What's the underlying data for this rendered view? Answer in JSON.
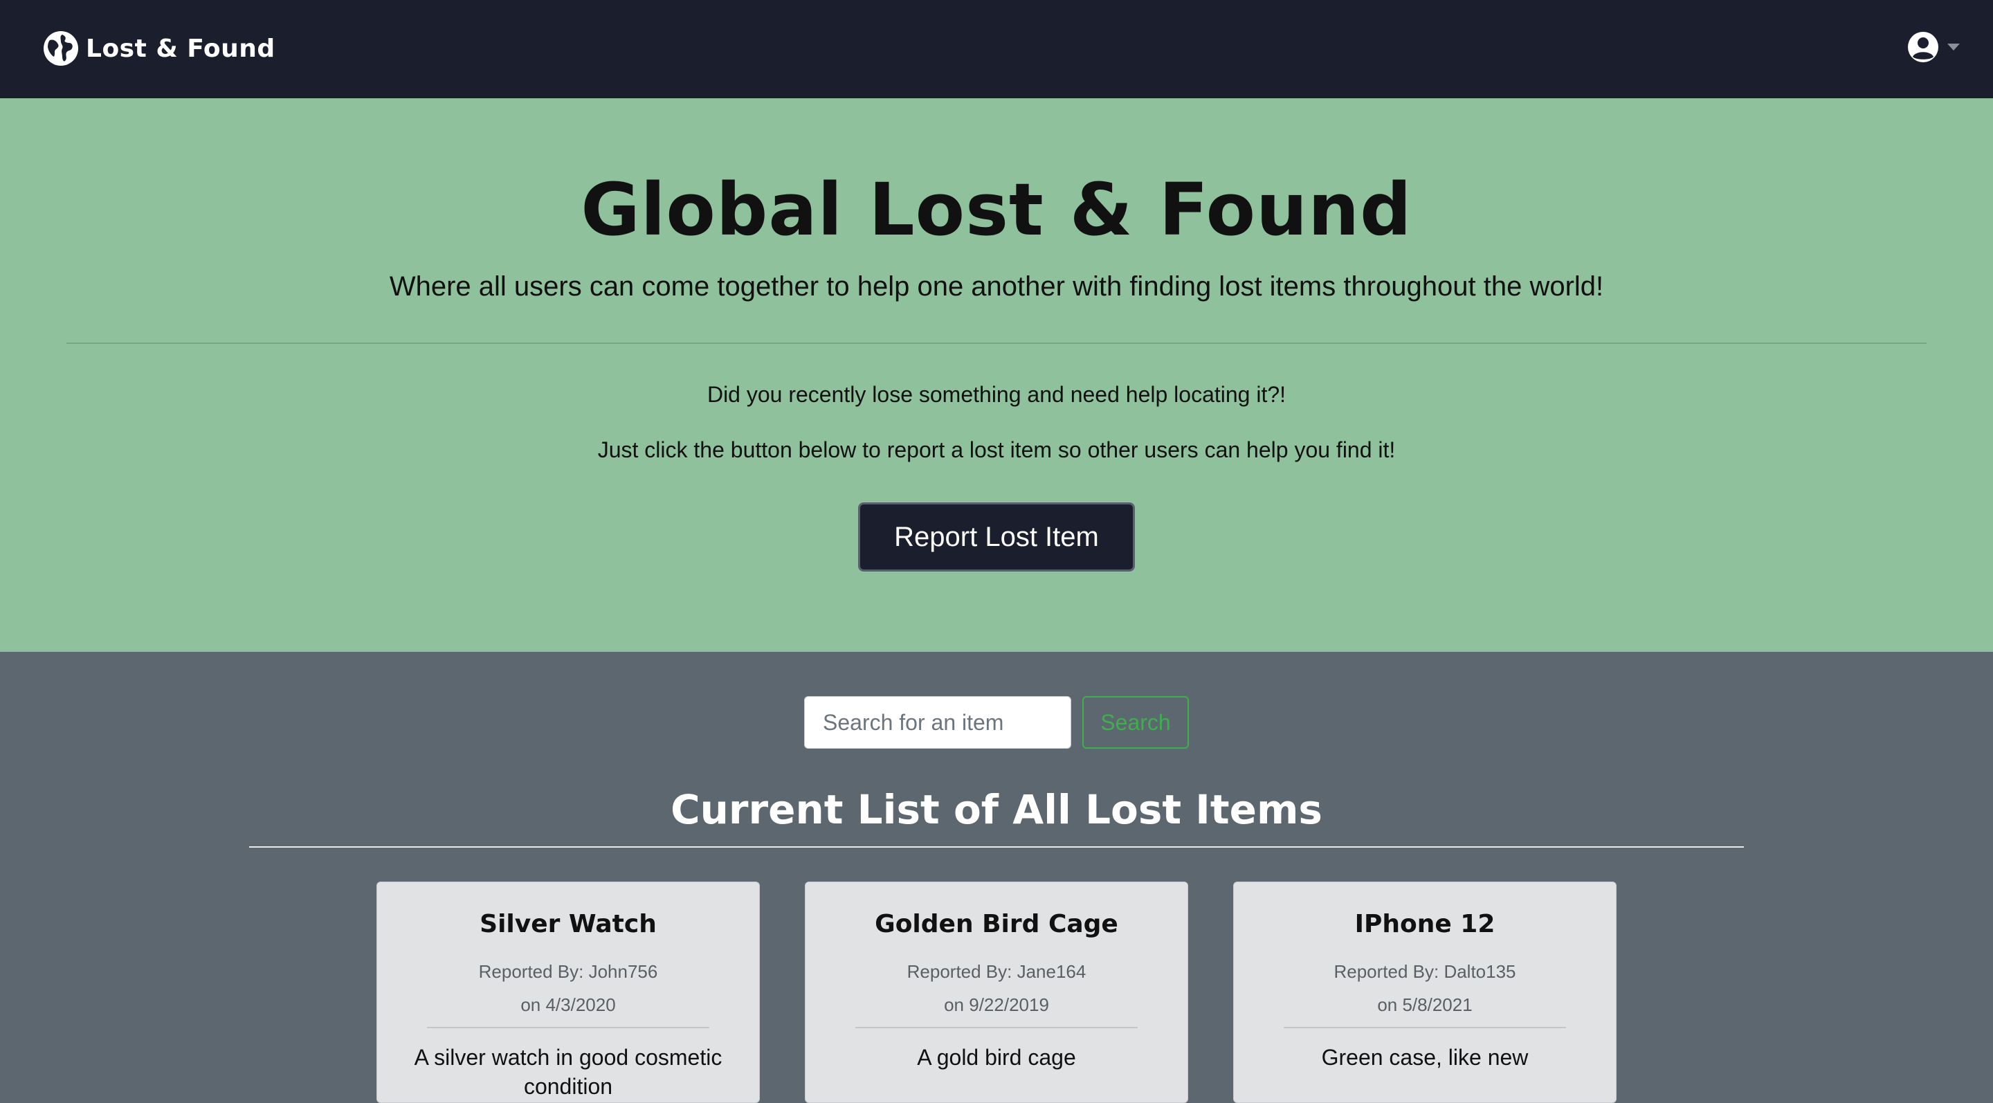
{
  "navbar": {
    "brand_label": "Lost & Found",
    "brand_icon": "globe-icon",
    "user_icon": "user-circle-icon",
    "dropdown_icon": "caret-down-icon"
  },
  "hero": {
    "title": "Global Lost & Found",
    "subtitle": "Where all users can come together to help one another with finding lost items throughout the world!",
    "line1": "Did you recently lose something and need help locating it?!",
    "line2": "Just click the button below to report a lost item so other users can help you find it!",
    "report_button_label": "Report Lost Item",
    "background_color": "#8ec19c"
  },
  "search": {
    "placeholder": "Search for an item",
    "value": "",
    "button_label": "Search",
    "accent_color": "#3fae4e"
  },
  "list": {
    "title": "Current List of All Lost Items",
    "items": [
      {
        "name": "Silver Watch",
        "reported_by": "Reported By: John756",
        "date": "on 4/3/2020",
        "description": "A silver watch in good cosmetic condition"
      },
      {
        "name": "Golden Bird Cage",
        "reported_by": "Reported By: Jane164",
        "date": "on 9/22/2019",
        "description": "A gold bird cage"
      },
      {
        "name": "IPhone 12",
        "reported_by": "Reported By: Dalto135",
        "date": "on 5/8/2021",
        "description": "Green case, like new"
      }
    ]
  },
  "colors": {
    "navbar": "#1b1e2c",
    "section_bg": "#5c6770",
    "card_bg": "#e1e2e4"
  }
}
